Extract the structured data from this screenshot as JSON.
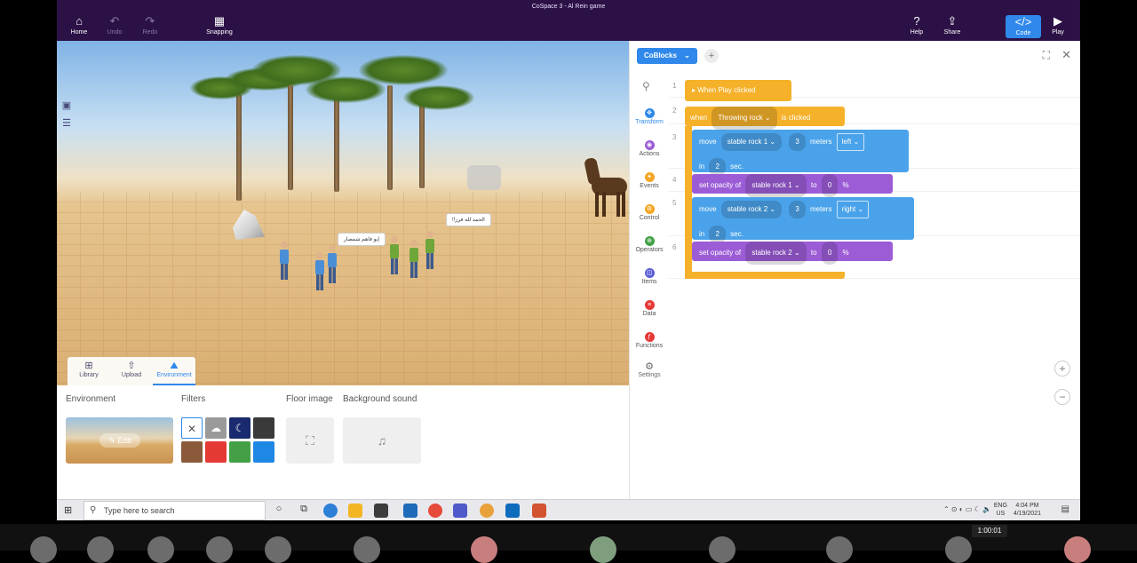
{
  "window": {
    "title": "CoSpace 3 - Al Rein game"
  },
  "toolbar": {
    "home": "Home",
    "undo": "Undo",
    "redo": "Redo",
    "snapping": "Snapping",
    "help": "Help",
    "share": "Share",
    "code": "Code",
    "play": "Play"
  },
  "scene": {
    "bubble_left": "إبو فاهم شمصار",
    "bubble_right": "!!الحمد لله فرز"
  },
  "library_tabs": {
    "library": "Library",
    "upload": "Upload",
    "environment": "Environment"
  },
  "bottom_panel": {
    "environment_title": "Environment",
    "filters_title": "Filters",
    "floor_title": "Floor image",
    "sound_title": "Background sound",
    "edit_label": "Edit",
    "swatch_colors": [
      "#ffffff",
      "#9a9a9a",
      "#1a2a6e",
      "#3a3a3a",
      "#8a5a3a",
      "#e53935",
      "#43a047",
      "#1e88e5"
    ]
  },
  "code_panel": {
    "tab_label": "CoBlocks",
    "categories": [
      "Transform",
      "Actions",
      "Events",
      "Control",
      "Operators",
      "Items",
      "Data",
      "Functions"
    ],
    "settings_label": "Settings",
    "category_colors": [
      "#2f88ea",
      "#9c5cd6",
      "#f5a623",
      "#f5a623",
      "#43a047",
      "#5b5bd6",
      "#e53935",
      "#e53935"
    ],
    "line_numbers": [
      "1",
      "2",
      "3",
      "4",
      "5",
      "6"
    ],
    "event_block": "When Play clicked",
    "when_block": {
      "when": "when",
      "object": "Throwing rock",
      "suffix": "is clicked"
    },
    "move1": {
      "verb": "move",
      "object": "stable rock 1",
      "amount": "3",
      "unit": "meters",
      "direction": "left",
      "in": "in",
      "seconds": "2",
      "sec": "sec."
    },
    "opacity1": {
      "verb": "set opacity of",
      "object": "stable rock 1",
      "to": "to",
      "value": "0",
      "unit": "%"
    },
    "move2": {
      "verb": "move",
      "object": "stable rock 2",
      "amount": "3",
      "unit": "meters",
      "direction": "right",
      "in": "in",
      "seconds": "2",
      "sec": "sec."
    },
    "opacity2": {
      "verb": "set opacity of",
      "object": "stable rock 2",
      "to": "to",
      "value": "0",
      "unit": "%"
    }
  },
  "taskbar": {
    "search_placeholder": "Type here to search",
    "lang_top": "ENG",
    "lang_bottom": "US",
    "time": "4:04 PM",
    "date": "4/19/2021"
  },
  "meeting": {
    "timer": "1:00:01"
  }
}
